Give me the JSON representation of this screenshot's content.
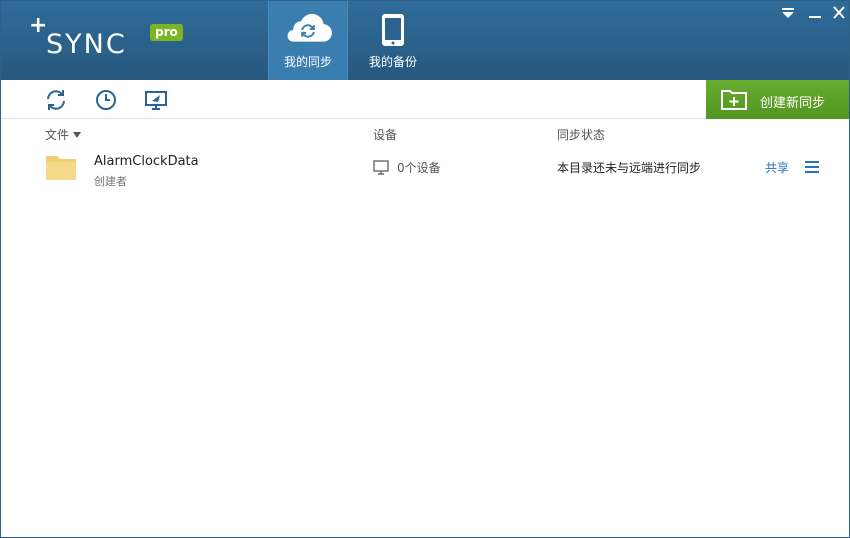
{
  "header": {
    "logo": {
      "plus": "+",
      "text": "SYNC",
      "badge": "pro"
    },
    "tabs": [
      {
        "label": "我的同步",
        "active": true,
        "icon": "cloud-sync-icon"
      },
      {
        "label": "我的备份",
        "active": false,
        "icon": "phone-icon"
      }
    ],
    "window_controls": {
      "menu": "▼",
      "minimize": "—",
      "close": "✕"
    }
  },
  "toolbar": {
    "icons": [
      "refresh-icon",
      "history-icon",
      "device-icon"
    ],
    "create_label": "创建新同步"
  },
  "table": {
    "columns": {
      "file": "文件",
      "devices": "设备",
      "status": "同步状态"
    },
    "rows": [
      {
        "name": "AlarmClockData",
        "creator": "创建者",
        "devices": "0个设备",
        "status": "本目录还未与远端进行同步",
        "share": "共享"
      }
    ]
  },
  "colors": {
    "header": "#2b6490",
    "active_tab": "#3a7eb0",
    "accent_green": "#5a9e25",
    "link_blue": "#2a73b8",
    "folder": "#f6d98a"
  }
}
